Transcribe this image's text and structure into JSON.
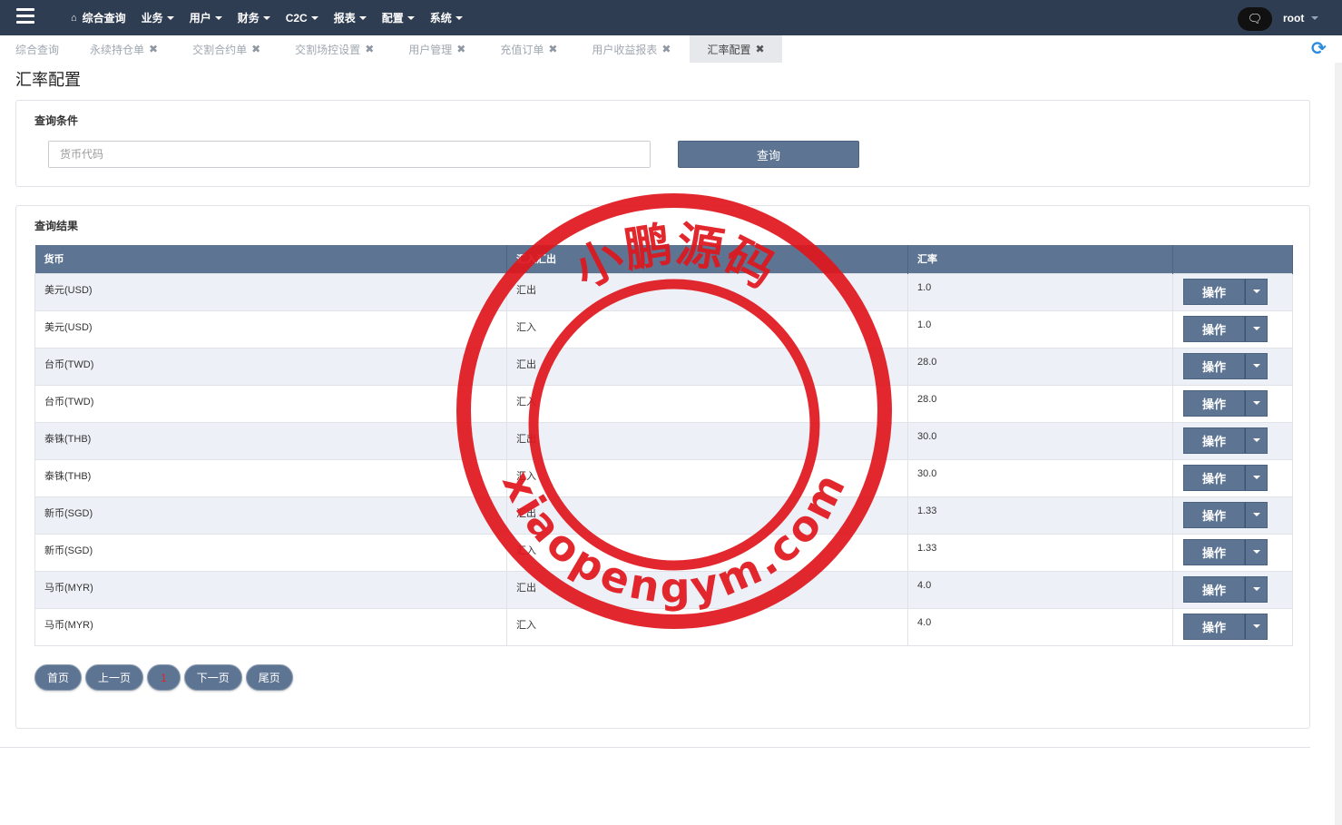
{
  "navbar": {
    "menu": [
      {
        "label": "综合查询",
        "icon": "home-icon",
        "dropdown": false
      },
      {
        "label": "业务",
        "dropdown": true
      },
      {
        "label": "用户",
        "dropdown": true
      },
      {
        "label": "财务",
        "dropdown": true
      },
      {
        "label": "C2C",
        "dropdown": true
      },
      {
        "label": "报表",
        "dropdown": true
      },
      {
        "label": "配置",
        "dropdown": true
      },
      {
        "label": "系统",
        "dropdown": true
      }
    ],
    "user": "root"
  },
  "tabs": [
    {
      "label": "综合查询",
      "closable": false,
      "active": false
    },
    {
      "label": "永续持仓单",
      "closable": true,
      "active": false
    },
    {
      "label": "交割合约单",
      "closable": true,
      "active": false
    },
    {
      "label": "交割场控设置",
      "closable": true,
      "active": false
    },
    {
      "label": "用户管理",
      "closable": true,
      "active": false
    },
    {
      "label": "充值订单",
      "closable": true,
      "active": false
    },
    {
      "label": "用户收益报表",
      "closable": true,
      "active": false
    },
    {
      "label": "汇率配置",
      "closable": true,
      "active": true
    }
  ],
  "page": {
    "title": "汇率配置"
  },
  "query": {
    "title": "查询条件",
    "input_placeholder": "货币代码",
    "input_value": "",
    "button_label": "查询"
  },
  "result": {
    "title": "查询结果",
    "columns": [
      "货币",
      "汇入汇出",
      "汇率",
      ""
    ],
    "rows": [
      {
        "currency": "美元(USD)",
        "direction": "汇出",
        "rate": "1.0"
      },
      {
        "currency": "美元(USD)",
        "direction": "汇入",
        "rate": "1.0"
      },
      {
        "currency": "台币(TWD)",
        "direction": "汇出",
        "rate": "28.0"
      },
      {
        "currency": "台币(TWD)",
        "direction": "汇入",
        "rate": "28.0"
      },
      {
        "currency": "泰铢(THB)",
        "direction": "汇出",
        "rate": "30.0"
      },
      {
        "currency": "泰铢(THB)",
        "direction": "汇入",
        "rate": "30.0"
      },
      {
        "currency": "新币(SGD)",
        "direction": "汇出",
        "rate": "1.33"
      },
      {
        "currency": "新币(SGD)",
        "direction": "汇入",
        "rate": "1.33"
      },
      {
        "currency": "马币(MYR)",
        "direction": "汇出",
        "rate": "4.0"
      },
      {
        "currency": "马币(MYR)",
        "direction": "汇入",
        "rate": "4.0"
      }
    ],
    "action_label": "操作"
  },
  "pagination": {
    "first": "首页",
    "prev": "上一页",
    "current": "1",
    "next": "下一页",
    "last": "尾页"
  },
  "watermark": {
    "top_text": "小鹏源码",
    "bottom_text": "xiaopengym.com",
    "color": "#e0161c"
  },
  "colors": {
    "navbar": "#2f3d52",
    "accent": "#5d7593",
    "row_alt": "#edf1f7"
  }
}
